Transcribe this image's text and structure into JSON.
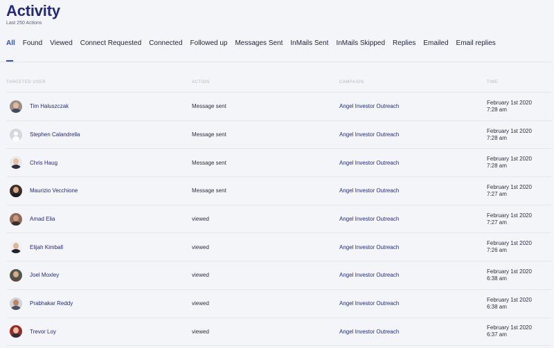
{
  "header": {
    "title": "Activity",
    "subtitle": "Last 250 Actions"
  },
  "tabs": [
    {
      "label": "All",
      "active": true
    },
    {
      "label": "Found"
    },
    {
      "label": "Viewed"
    },
    {
      "label": "Connect Requested"
    },
    {
      "label": "Connected"
    },
    {
      "label": "Followed up"
    },
    {
      "label": "Messages Sent"
    },
    {
      "label": "InMails Sent"
    },
    {
      "label": "InMails Skipped"
    },
    {
      "label": "Replies"
    },
    {
      "label": "Emailed"
    },
    {
      "label": "Email replies"
    }
  ],
  "table": {
    "headers": {
      "user": "Targeted User",
      "action": "Action",
      "campaign": "Campaign",
      "time": "Time"
    },
    "rows": [
      {
        "name": "Tim Haluszczak",
        "action": "Message sent",
        "campaign": "Angel Investor Outreach",
        "date": "February 1st 2020",
        "time": "7:28 am",
        "avatar_bg": "#9a8f86",
        "skin": "#e3b99c",
        "shirt": "#3f4a63"
      },
      {
        "name": "Stephen Calandrella",
        "action": "Message sent",
        "campaign": "Angel Investor Outreach",
        "date": "February 1st 2020",
        "time": "7:28 am",
        "avatar_bg": "#d4d6e0",
        "placeholder": true
      },
      {
        "name": "Chris Haug",
        "action": "Message sent",
        "campaign": "Angel Investor Outreach",
        "date": "February 1st 2020",
        "time": "7:28 am",
        "avatar_bg": "#e9e9ec",
        "skin": "#e6bfa4",
        "shirt": "#2c3142"
      },
      {
        "name": "Maurizio Vecchione",
        "action": "Message sent",
        "campaign": "Angel Investor Outreach",
        "date": "February 1st 2020",
        "time": "7:27 am",
        "avatar_bg": "#3a2c28",
        "skin": "#d7a888",
        "shirt": "#1b1d25"
      },
      {
        "name": "Amad Elia",
        "action": "viewed",
        "campaign": "Angel Investor Outreach",
        "date": "February 1st 2020",
        "time": "7:27 am",
        "avatar_bg": "#8f6a5b",
        "skin": "#c9977a",
        "shirt": "#3b3030"
      },
      {
        "name": "Elijah Kimball",
        "action": "viewed",
        "campaign": "Angel Investor Outreach",
        "date": "February 1st 2020",
        "time": "7:26 am",
        "avatar_bg": "#f1f1f3",
        "skin": "#e0b497",
        "shirt": "#20232c"
      },
      {
        "name": "Joel Moxley",
        "action": "viewed",
        "campaign": "Angel Investor Outreach",
        "date": "February 1st 2020",
        "time": "6:38 am",
        "avatar_bg": "#4f5a4a",
        "skin": "#d8a98a",
        "shirt": "#5a4d3f"
      },
      {
        "name": "Prabhakar Reddy",
        "action": "viewed",
        "campaign": "Angel Investor Outreach",
        "date": "February 1st 2020",
        "time": "6:38 am",
        "avatar_bg": "#d2d2d6",
        "skin": "#b88667",
        "shirt": "#4a4f62"
      },
      {
        "name": "Trevor Loy",
        "action": "viewed",
        "campaign": "Angel Investor Outreach",
        "date": "February 1st 2020",
        "time": "6:37 am",
        "avatar_bg": "#9a2a2a",
        "skin": "#e7bfa3",
        "shirt": "#2d2f3a"
      }
    ]
  },
  "colors": {
    "accent": "#2d4cd6",
    "title": "#232a7a",
    "background": "#f4f5f9"
  }
}
